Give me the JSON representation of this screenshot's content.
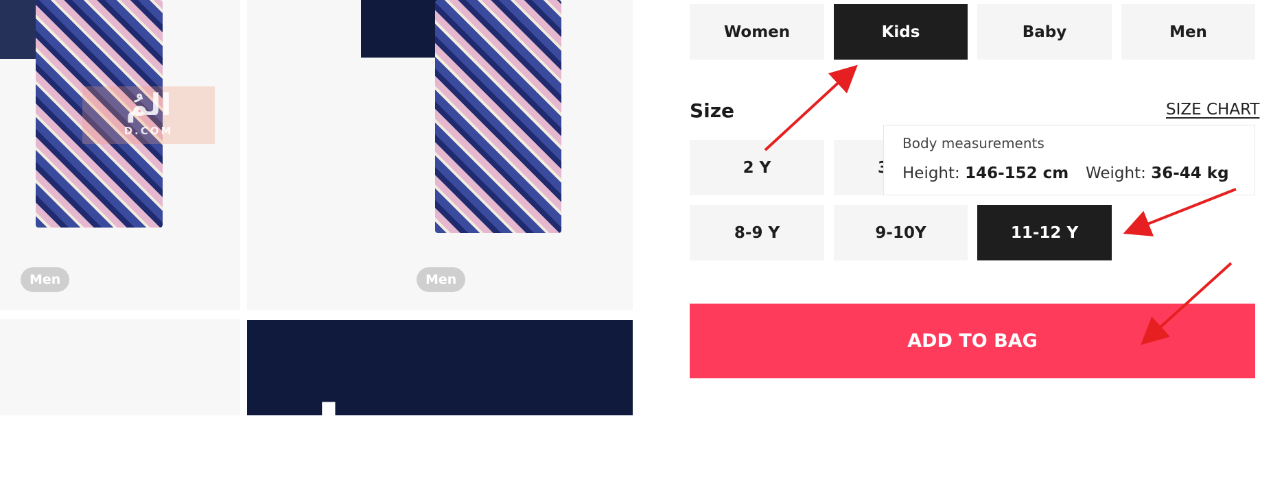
{
  "gallery": {
    "badge_left": "Men",
    "badge_right": "Men",
    "watermark_main": "المُ",
    "watermark_sub": "D.COM",
    "bottom_big_text": "l ."
  },
  "departments": [
    {
      "label": "Women",
      "selected": false
    },
    {
      "label": "Kids",
      "selected": true
    },
    {
      "label": "Baby",
      "selected": false
    },
    {
      "label": "Men",
      "selected": false
    }
  ],
  "size": {
    "label": "Size",
    "chart_link": "SIZE CHART",
    "options": [
      {
        "label": "2 Y",
        "selected": false
      },
      {
        "label": "3",
        "selected": false
      },
      {
        "label": "8-9 Y",
        "selected": false
      },
      {
        "label": "9-10Y",
        "selected": false
      },
      {
        "label": "11-12 Y",
        "selected": true
      }
    ]
  },
  "tooltip": {
    "title": "Body measurements",
    "height_label": "Height: ",
    "height_value": "146-152 cm",
    "weight_label": "Weight: ",
    "weight_value": "36-44 kg"
  },
  "cta": {
    "label": "ADD TO BAG",
    "color": "#ff3b5c"
  },
  "annotation_color": "#e62020"
}
